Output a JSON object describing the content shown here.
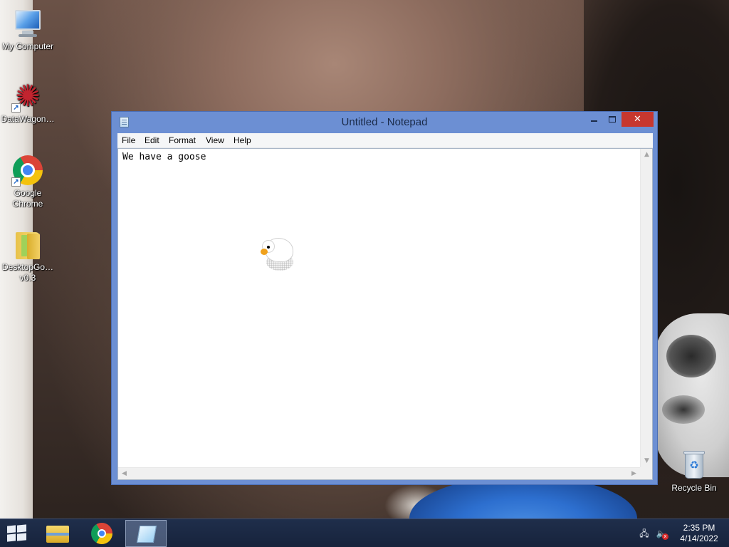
{
  "desktop": {
    "icons": [
      {
        "label": "My Computer",
        "icon": "computer-icon"
      },
      {
        "label": "DataWagon…",
        "icon": "datawagon-icon"
      },
      {
        "label": "Google Chrome",
        "icon": "chrome-icon"
      },
      {
        "label": "DesktopGo… v0.3",
        "icon": "folder-icon"
      },
      {
        "label": "Recycle Bin",
        "icon": "recycle-bin-icon"
      }
    ]
  },
  "notepad": {
    "title": "Untitled - Notepad",
    "controls": {
      "minimize": "minimize-icon",
      "maximize": "maximize-icon",
      "close": "✕"
    },
    "menu": [
      "File",
      "Edit",
      "Format",
      "View",
      "Help"
    ],
    "content": "We have a goose"
  },
  "taskbar": {
    "apps": [
      "File Explorer",
      "Google Chrome",
      "Notepad"
    ],
    "active_app": "Notepad",
    "tray": {
      "network": "network-icon",
      "volume": "volume-muted-icon"
    },
    "clock": {
      "time": "2:35 PM",
      "date": "4/14/2022"
    }
  }
}
